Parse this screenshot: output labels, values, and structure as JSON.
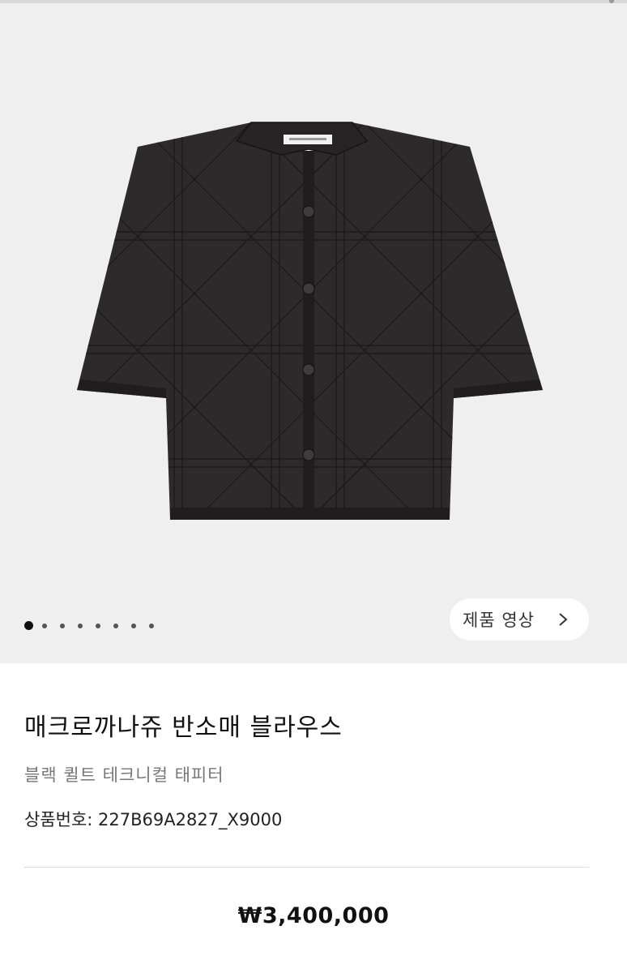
{
  "gallery": {
    "image_icon": "quilted-jacket-product-image",
    "slide_count": 8,
    "active_slide": 1,
    "video_button_label": "제품 영상",
    "video_button_icon": "chevron-right-icon"
  },
  "product": {
    "name": "매크로까나쥬 반소매 블라우스",
    "subtitle": "블랙 퀼트 테크니컬 태피터",
    "code": "상품번호: 227B69A2827_X9000",
    "price": "₩3,400,000"
  },
  "colors": {
    "gallery_bg": "#efefef",
    "jacket": "#2c2a2b"
  }
}
